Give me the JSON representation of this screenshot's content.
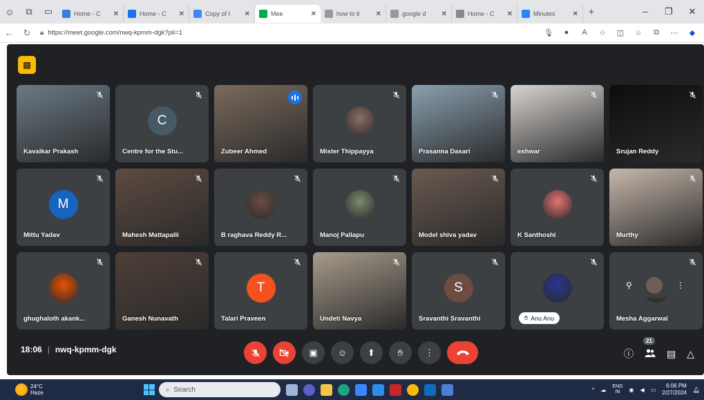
{
  "browser": {
    "tabs": [
      {
        "title": "Home - C",
        "fav": "#3b7ddd"
      },
      {
        "title": "Home - C",
        "fav": "#1a73e8"
      },
      {
        "title": "Copy of I",
        "fav": "#4285f4"
      },
      {
        "title": "Mee",
        "fav": "#00ac47",
        "active": true
      },
      {
        "title": "how to ti",
        "fav": "#999999"
      },
      {
        "title": "google d",
        "fav": "#999999"
      },
      {
        "title": "Home - C",
        "fav": "#888888"
      },
      {
        "title": "Minutes",
        "fav": "#2684fc"
      }
    ],
    "url": "https://meet.google.com/nwq-kpmm-dgk?pli=1"
  },
  "meet": {
    "tiles": [
      {
        "name": "Kavalkar Prakash",
        "kind": "video",
        "bg": "#6b7a86"
      },
      {
        "name": "Centre for the Stu...",
        "kind": "letter",
        "letter": "C",
        "color": "#455a64"
      },
      {
        "name": "Zubeer Ahmed",
        "kind": "video",
        "bg": "#7a6a5c",
        "speaking": true
      },
      {
        "name": "Mister Thippayya",
        "kind": "photo",
        "bg": "#8d6e63"
      },
      {
        "name": "Prasanna Dasari",
        "kind": "video",
        "bg": "#8aa0b0"
      },
      {
        "name": "eshwar",
        "kind": "video",
        "bg": "#d8d4d0"
      },
      {
        "name": "Srujan Reddy",
        "kind": "video",
        "bg": "#0d0d0d"
      },
      {
        "name": "Mittu Yadav",
        "kind": "letter",
        "letter": "M",
        "color": "#1565c0"
      },
      {
        "name": "Mahesh Mattapalli",
        "kind": "video",
        "bg": "#5d4b40"
      },
      {
        "name": "B raghava Reddy R...",
        "kind": "photo",
        "bg": "#6d4c41"
      },
      {
        "name": "Manoj Pallapu",
        "kind": "photo",
        "bg": "#7b8a6b"
      },
      {
        "name": "Model shiva yadav",
        "kind": "video",
        "bg": "#6a5a50"
      },
      {
        "name": "K Santhoshi",
        "kind": "photo",
        "bg": "#e57373"
      },
      {
        "name": "Murthy",
        "kind": "video",
        "bg": "#c7b8ab"
      },
      {
        "name": "ghughaloth akank...",
        "kind": "photo",
        "bg": "#e65100"
      },
      {
        "name": "Ganesh Nunavath",
        "kind": "video",
        "bg": "#4e3f38"
      },
      {
        "name": "Talari Praveen",
        "kind": "letter",
        "letter": "T",
        "color": "#f4511e"
      },
      {
        "name": "Undeti Navya",
        "kind": "video",
        "bg": "#a89c8c"
      },
      {
        "name": "Sravanthi Sravanthi",
        "kind": "letter",
        "letter": "S",
        "color": "#6d4c41"
      },
      {
        "name": "",
        "kind": "photo",
        "bg": "#283593",
        "chip": "Anu Anu"
      },
      {
        "name": "Mesha Aggarwal",
        "kind": "photo",
        "bg": "#3c4043",
        "hover": true
      }
    ],
    "time": "18:06",
    "meeting_code": "nwq-kpmm-dgk",
    "participants_count": "21"
  },
  "taskbar": {
    "temp": "24°C",
    "weather": "Haze",
    "search_placeholder": "Search",
    "lang_top": "ENG",
    "lang_bottom": "IN",
    "time": "6:06 PM",
    "date": "2/27/2024"
  }
}
